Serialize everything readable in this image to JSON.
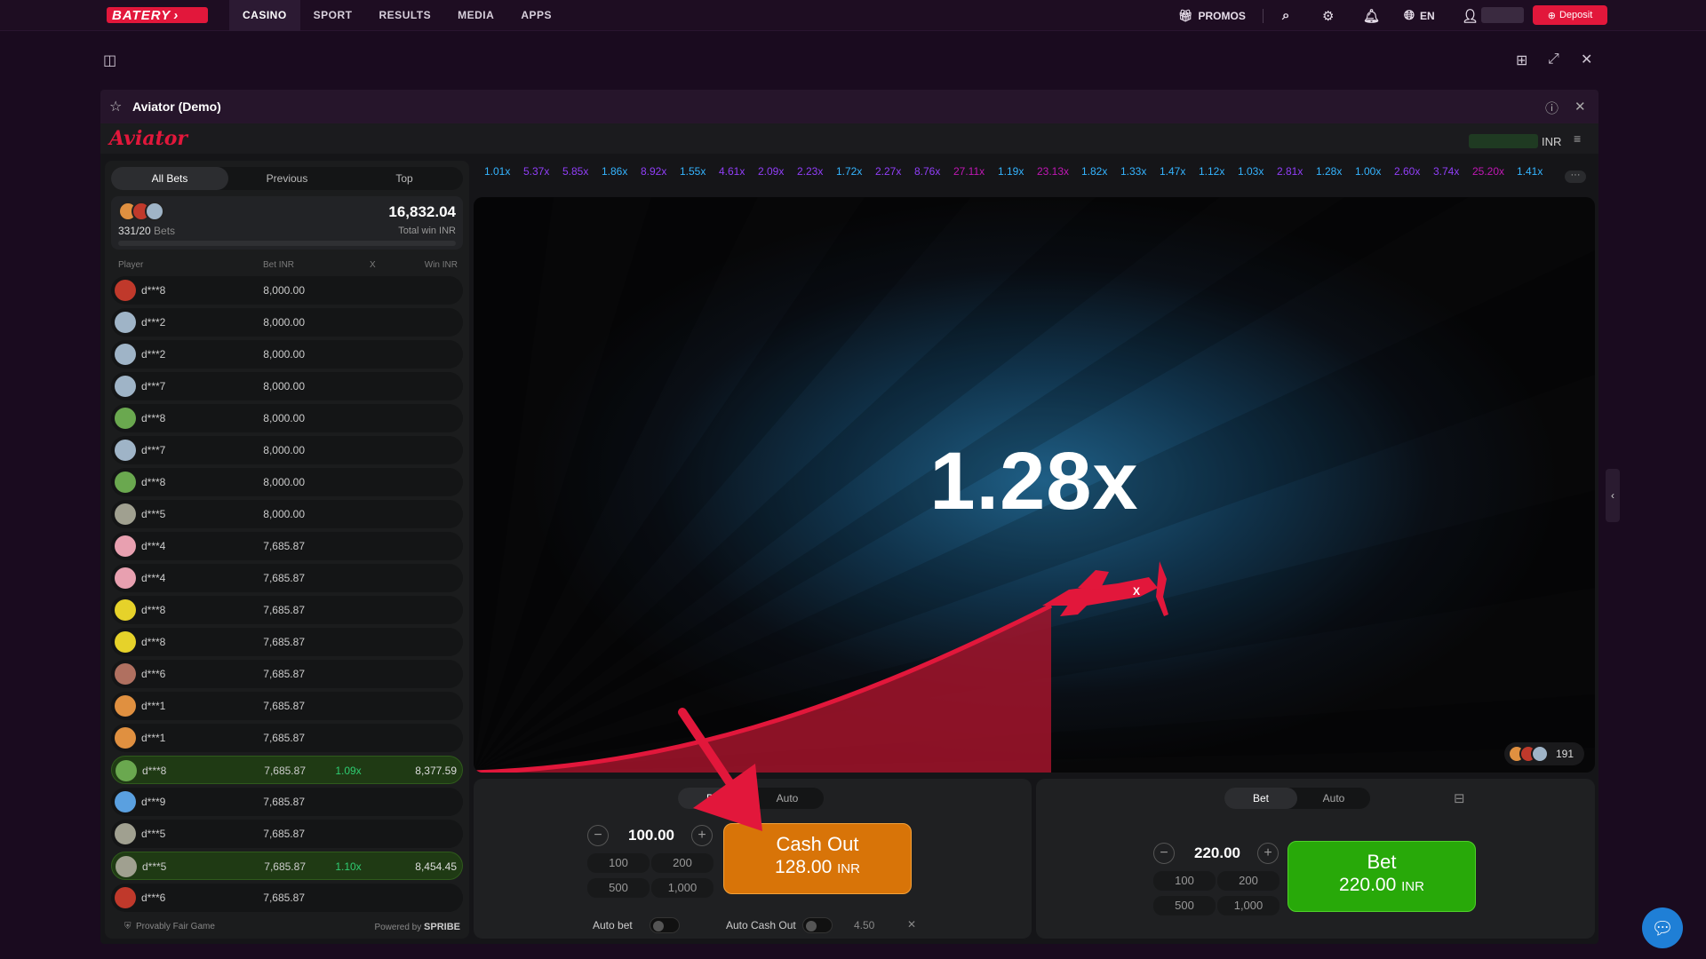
{
  "topnav": {
    "logo": "BATERY",
    "items": [
      "CASINO",
      "SPORT",
      "RESULTS",
      "MEDIA",
      "APPS"
    ],
    "active": "CASINO",
    "promos": "PROMOS",
    "lang": "EN",
    "deposit": "Deposit"
  },
  "window": {
    "title": "Aviator (Demo)"
  },
  "aviator": {
    "logo": "Aviator",
    "currency": "INR"
  },
  "bets_panel": {
    "tabs": [
      "All Bets",
      "Previous",
      "Top"
    ],
    "active_tab": "All Bets",
    "bets_count": "331/20",
    "bets_label": "Bets",
    "total_win": "16,832.04",
    "total_win_label": "Total win INR",
    "columns": {
      "player": "Player",
      "bet": "Bet INR",
      "x": "X",
      "win": "Win INR"
    },
    "rows": [
      {
        "player": "d***8",
        "bet": "8,000.00",
        "mult": "",
        "win": "",
        "avatar": "#c0392b"
      },
      {
        "player": "d***2",
        "bet": "8,000.00",
        "mult": "",
        "win": "",
        "avatar": "#9fb4c7"
      },
      {
        "player": "d***2",
        "bet": "8,000.00",
        "mult": "",
        "win": "",
        "avatar": "#9fb4c7"
      },
      {
        "player": "d***7",
        "bet": "8,000.00",
        "mult": "",
        "win": "",
        "avatar": "#9fb4c7"
      },
      {
        "player": "d***8",
        "bet": "8,000.00",
        "mult": "",
        "win": "",
        "avatar": "#6aa84f"
      },
      {
        "player": "d***7",
        "bet": "8,000.00",
        "mult": "",
        "win": "",
        "avatar": "#9fb4c7"
      },
      {
        "player": "d***8",
        "bet": "8,000.00",
        "mult": "",
        "win": "",
        "avatar": "#6aa84f"
      },
      {
        "player": "d***5",
        "bet": "8,000.00",
        "mult": "",
        "win": "",
        "avatar": "#a0a090"
      },
      {
        "player": "d***4",
        "bet": "7,685.87",
        "mult": "",
        "win": "",
        "avatar": "#e8a0b0"
      },
      {
        "player": "d***4",
        "bet": "7,685.87",
        "mult": "",
        "win": "",
        "avatar": "#e8a0b0"
      },
      {
        "player": "d***8",
        "bet": "7,685.87",
        "mult": "",
        "win": "",
        "avatar": "#e6d22a"
      },
      {
        "player": "d***8",
        "bet": "7,685.87",
        "mult": "",
        "win": "",
        "avatar": "#e6d22a"
      },
      {
        "player": "d***6",
        "bet": "7,685.87",
        "mult": "",
        "win": "",
        "avatar": "#b07060"
      },
      {
        "player": "d***1",
        "bet": "7,685.87",
        "mult": "",
        "win": "",
        "avatar": "#e09040"
      },
      {
        "player": "d***1",
        "bet": "7,685.87",
        "mult": "",
        "win": "",
        "avatar": "#e09040"
      },
      {
        "player": "d***8",
        "bet": "7,685.87",
        "mult": "1.09x",
        "win": "8,377.59",
        "avatar": "#6aa84f",
        "win_row": true
      },
      {
        "player": "d***9",
        "bet": "7,685.87",
        "mult": "",
        "win": "",
        "avatar": "#5aa0e0"
      },
      {
        "player": "d***5",
        "bet": "7,685.87",
        "mult": "",
        "win": "",
        "avatar": "#a0a090"
      },
      {
        "player": "d***5",
        "bet": "7,685.87",
        "mult": "1.10x",
        "win": "8,454.45",
        "avatar": "#a0a090",
        "win_row": true
      },
      {
        "player": "d***6",
        "bet": "7,685.87",
        "mult": "",
        "win": "",
        "avatar": "#c0392b"
      }
    ],
    "footer_left": "Provably Fair Game",
    "footer_right_prefix": "Powered by",
    "footer_right_brand": "SPRIBE"
  },
  "history": [
    {
      "v": "1.01x",
      "c": "#34b4ff"
    },
    {
      "v": "5.37x",
      "c": "#913ef8"
    },
    {
      "v": "5.85x",
      "c": "#913ef8"
    },
    {
      "v": "1.86x",
      "c": "#34b4ff"
    },
    {
      "v": "8.92x",
      "c": "#913ef8"
    },
    {
      "v": "1.55x",
      "c": "#34b4ff"
    },
    {
      "v": "4.61x",
      "c": "#913ef8"
    },
    {
      "v": "2.09x",
      "c": "#913ef8"
    },
    {
      "v": "2.23x",
      "c": "#913ef8"
    },
    {
      "v": "1.72x",
      "c": "#34b4ff"
    },
    {
      "v": "2.27x",
      "c": "#913ef8"
    },
    {
      "v": "8.76x",
      "c": "#913ef8"
    },
    {
      "v": "27.11x",
      "c": "#c017b4"
    },
    {
      "v": "1.19x",
      "c": "#34b4ff"
    },
    {
      "v": "23.13x",
      "c": "#c017b4"
    },
    {
      "v": "1.82x",
      "c": "#34b4ff"
    },
    {
      "v": "1.33x",
      "c": "#34b4ff"
    },
    {
      "v": "1.47x",
      "c": "#34b4ff"
    },
    {
      "v": "1.12x",
      "c": "#34b4ff"
    },
    {
      "v": "1.03x",
      "c": "#34b4ff"
    },
    {
      "v": "2.81x",
      "c": "#913ef8"
    },
    {
      "v": "1.28x",
      "c": "#34b4ff"
    },
    {
      "v": "1.00x",
      "c": "#34b4ff"
    },
    {
      "v": "2.60x",
      "c": "#913ef8"
    },
    {
      "v": "3.74x",
      "c": "#913ef8"
    },
    {
      "v": "25.20x",
      "c": "#c017b4"
    },
    {
      "v": "1.41x",
      "c": "#34b4ff"
    }
  ],
  "game": {
    "multiplier": "1.28x",
    "players_online": "191"
  },
  "bet_panel_1": {
    "tabs": [
      "Bet",
      "Auto"
    ],
    "amount": "100.00",
    "quick": [
      "100",
      "200",
      "500",
      "1,000"
    ],
    "button_line1": "Cash Out",
    "button_amount": "128.00",
    "button_currency": "INR",
    "auto_bet": "Auto bet",
    "auto_cashout": "Auto Cash Out",
    "auto_cashout_value": "4.50"
  },
  "bet_panel_2": {
    "tabs": [
      "Bet",
      "Auto"
    ],
    "amount": "220.00",
    "quick": [
      "100",
      "200",
      "500",
      "1,000"
    ],
    "button_line1": "Bet",
    "button_amount": "220.00",
    "button_currency": "INR"
  },
  "colors": {
    "brand_red": "#e2173b",
    "cashout_orange": "#d87408",
    "bet_green": "#28a909",
    "win_green": "#2ecc71"
  }
}
